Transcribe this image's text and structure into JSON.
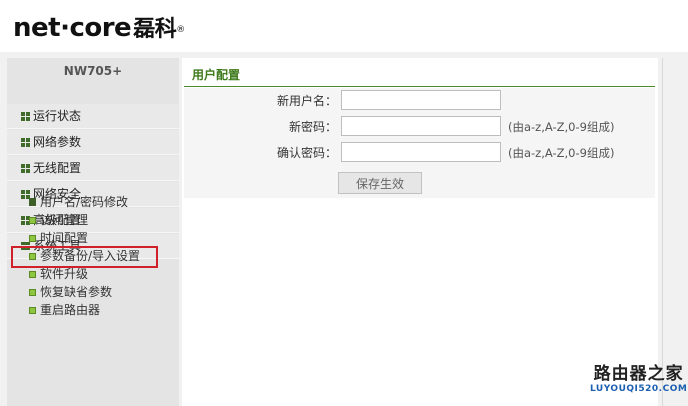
{
  "brand": {
    "logo_text": "net·core磊科",
    "logo_en": "net·core",
    "logo_cn": "磊科",
    "reg_mark": "®"
  },
  "device": {
    "model": "NW705+"
  },
  "sidebar": {
    "items": [
      {
        "label": "运行状态",
        "icon": "grid-icon"
      },
      {
        "label": "网络参数",
        "icon": "grid-icon"
      },
      {
        "label": "无线配置",
        "icon": "grid-icon"
      },
      {
        "label": "网络安全",
        "icon": "grid-icon"
      },
      {
        "label": "高级配置",
        "icon": "grid-icon"
      },
      {
        "label": "系统工具",
        "icon": "expanded-icon"
      }
    ],
    "submenu": [
      {
        "label": "用户名/密码修改",
        "active": true
      },
      {
        "label": "访问管理"
      },
      {
        "label": "时间配置"
      },
      {
        "label": "参数备份/导入设置"
      },
      {
        "label": "软件升级"
      },
      {
        "label": "恢复缺省参数"
      },
      {
        "label": "重启路由器"
      }
    ]
  },
  "main": {
    "title": "用户配置",
    "fields": [
      {
        "label": "新用户名：",
        "value": "",
        "hint": ""
      },
      {
        "label": "新密码：",
        "value": "",
        "hint": "(由a-z,A-Z,0-9组成)"
      },
      {
        "label": "确认密码：",
        "value": "",
        "hint": "(由a-z,A-Z,0-9组成)"
      }
    ],
    "save_label": "保存生效"
  },
  "watermark": {
    "cn": "路由器之家",
    "en": "LUYOUQI520.COM"
  },
  "colors": {
    "accent_green": "#3e7a1c",
    "highlight_red": "#d0202a",
    "watermark_blue": "#1c5fb0"
  }
}
